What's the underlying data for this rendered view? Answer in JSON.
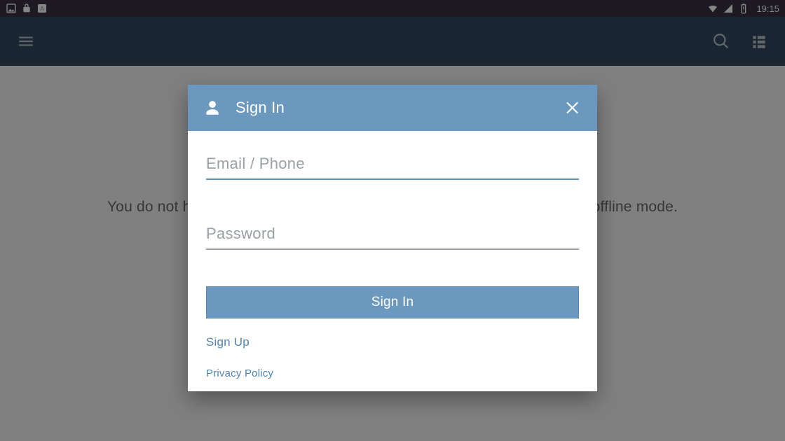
{
  "statusbar": {
    "time": "19:15",
    "icons_left": [
      "image-icon",
      "lock-icon",
      "letter-a-icon"
    ],
    "icons_right": [
      "wifi-icon",
      "cellular-icon",
      "battery-charging-icon"
    ]
  },
  "toolbar": {
    "left_icon": "hamburger-menu-icon",
    "right_icons": [
      "search-icon",
      "view-list-icon"
    ]
  },
  "content": {
    "offline_message": "You do not have downloaded files. Please download chapters for read in offline mode."
  },
  "dialog": {
    "title": "Sign In",
    "header_icon": "person-icon",
    "close_icon": "close-icon",
    "email_placeholder": "Email / Phone",
    "email_value": "",
    "password_placeholder": "Password",
    "password_value": "",
    "signin_button": "Sign In",
    "signup_link": "Sign Up",
    "privacy_link": "Privacy Policy"
  },
  "colors": {
    "statusbar_bg": "#383246",
    "toolbar_bg": "#324b63",
    "dialog_header_bg": "#6b98bf",
    "accent": "#6b98bf",
    "link": "#4f85b3"
  }
}
